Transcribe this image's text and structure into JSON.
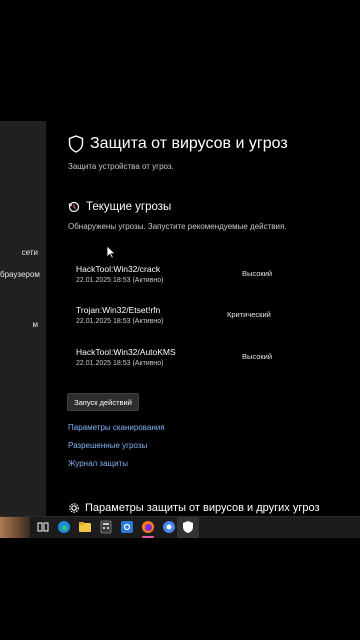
{
  "sidebar": {
    "items": [
      {
        "label": "сети"
      },
      {
        "label": "браузером"
      },
      {
        "label": "м"
      }
    ]
  },
  "page": {
    "title": "Защита от вирусов и угроз",
    "subtitle": "Защита устройства от угроз."
  },
  "current_threats": {
    "title": "Текущие угрозы",
    "description": "Обнаружены угрозы. Запустите рекомендуемые действия.",
    "items": [
      {
        "name": "HackTool:Win32/crack",
        "date": "22.01.2025 18:53 (Активно)",
        "level": "Высокий"
      },
      {
        "name": "Trojan:Win32/Etset!rfn",
        "date": "22.01.2025 18:53 (Активно)",
        "level": "Критический"
      },
      {
        "name": "HackTool:Win32/AutoKMS",
        "date": "22.01.2025 18:53 (Активно)",
        "level": "Высокий"
      }
    ],
    "action_button": "Запуск действий",
    "links": {
      "scan_options": "Параметры сканирования",
      "allowed_threats": "Разрешенные угрозы",
      "protection_history": "Журнал защиты"
    }
  },
  "settings_section": {
    "title": "Параметры защиты от вирусов и других угроз"
  },
  "colors": {
    "background": "#000000",
    "sidebar": "#202020",
    "link": "#7fb2f5",
    "taskbar": "#1c1c1c",
    "active_indicator": "#e05aa4"
  },
  "taskbar": {
    "icons": [
      "task-view-icon",
      "edge-icon",
      "file-explorer-icon",
      "calculator-icon",
      "settings-icon",
      "firefox-icon",
      "chrome-icon",
      "windows-security-icon"
    ]
  }
}
